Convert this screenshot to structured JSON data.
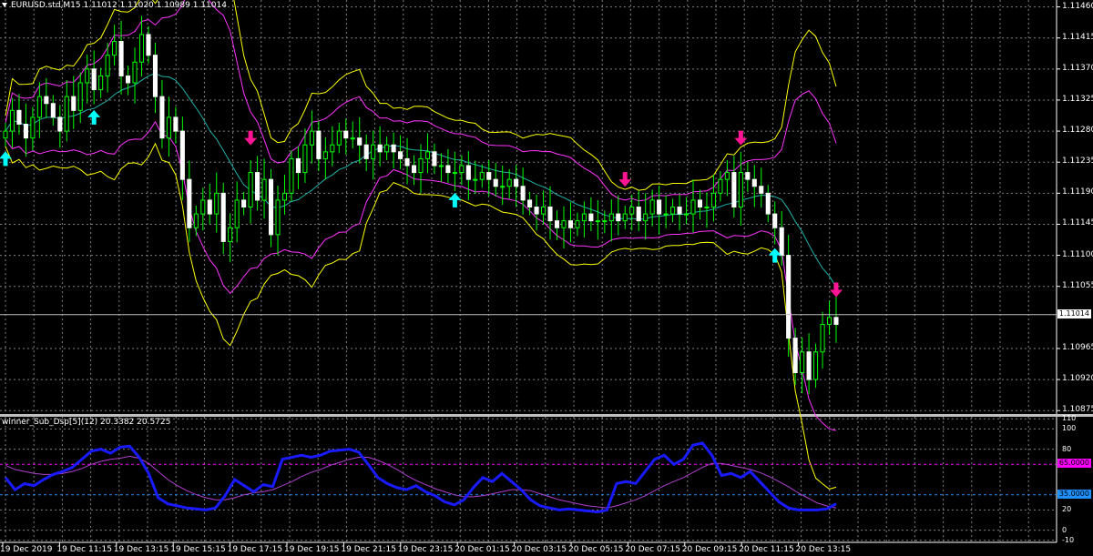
{
  "chart": {
    "symbol_title": "EURUSD.std,M15  1.11012 1.11020 1.10989 1.11014",
    "current_price": "1.11014",
    "price_ticks": [
      "1.11460",
      "1.11415",
      "1.11370",
      "1.11325",
      "1.11280",
      "1.11235",
      "1.11190",
      "1.11145",
      "1.11100",
      "1.11055",
      "1.10965",
      "1.10920",
      "1.10875"
    ]
  },
  "indicator": {
    "title": "winner_Sub_Dsp[5](12) 20.3382 20.5725",
    "level_high": "65.0000",
    "level_low": "35.0000",
    "ticks": [
      "110",
      "100",
      "80",
      "20",
      "0",
      "-10"
    ]
  },
  "time_axis": [
    "19 Dec 2019",
    "19 Dec 11:15",
    "19 Dec 13:15",
    "19 Dec 15:15",
    "19 Dec 17:15",
    "19 Dec 19:15",
    "19 Dec 21:15",
    "19 Dec 23:15",
    "20 Dec 01:15",
    "20 Dec 03:15",
    "20 Dec 05:15",
    "20 Dec 07:15",
    "20 Dec 09:15",
    "20 Dec 11:15",
    "20 Dec 13:15"
  ],
  "colors": {
    "background": "#000000",
    "grid": "#7f7f7f",
    "bull_candle": "#ffffff",
    "bear_candle": "#ffffff",
    "wick": "#00ff00",
    "band_outer": "#ffff00",
    "band_mid": "#ff33ff",
    "band_center": "#20b2aa",
    "arrow_up": "#00ffff",
    "arrow_down": "#ff1493",
    "osc_fast": "#1a1aff",
    "osc_slow": "#b040d0",
    "level_high": "#ff00ff",
    "level_low": "#1e90ff"
  },
  "chart_data": {
    "type": "candlestick",
    "closes": [
      1.1128,
      1.1131,
      1.1129,
      1.1127,
      1.113,
      1.1133,
      1.1132,
      1.113,
      1.1128,
      1.1133,
      1.1131,
      1.1135,
      1.1137,
      1.1134,
      1.1136,
      1.1139,
      1.1141,
      1.1136,
      1.1135,
      1.1138,
      1.1142,
      1.1139,
      1.1133,
      1.1127,
      1.113,
      1.1128,
      1.1121,
      1.1114,
      1.1116,
      1.1118,
      1.1116,
      1.1119,
      1.1112,
      1.1114,
      1.1118,
      1.1117,
      1.1122,
      1.1118,
      1.1121,
      1.1113,
      1.1118,
      1.1119,
      1.1124,
      1.1122,
      1.1126,
      1.1128,
      1.1124,
      1.1125,
      1.1126,
      1.1128,
      1.1127,
      1.1127,
      1.1126,
      1.1124,
      1.1126,
      1.1125,
      1.1126,
      1.1125,
      1.1124,
      1.1123,
      1.1122,
      1.1124,
      1.1125,
      1.1123,
      1.1123,
      1.1122,
      1.1122,
      1.1123,
      1.1121,
      1.1121,
      1.1122,
      1.1121,
      1.112,
      1.112,
      1.1121,
      1.112,
      1.1118,
      1.1117,
      1.1116,
      1.1117,
      1.1115,
      1.1114,
      1.1115,
      1.1114,
      1.1115,
      1.1116,
      1.1115,
      1.1115,
      1.1115,
      1.1116,
      1.1115,
      1.1116,
      1.1117,
      1.1115,
      1.1116,
      1.1118,
      1.1116,
      1.1116,
      1.1117,
      1.1116,
      1.1116,
      1.1118,
      1.1117,
      1.1117,
      1.1119,
      1.1121,
      1.1122,
      1.1117,
      1.1122,
      1.1121,
      1.112,
      1.1119,
      1.1116,
      1.1114,
      1.111,
      1.1098,
      1.1093,
      1.1096,
      1.1092,
      1.1096,
      1.11,
      1.1101,
      1.11
    ],
    "buy_arrows_at_bar": [
      0,
      13,
      66,
      113
    ],
    "sell_arrows_at_bar": [
      36,
      91,
      108,
      127
    ],
    "oscillator_fast": [
      52,
      40,
      46,
      44,
      50,
      55,
      58,
      62,
      70,
      78,
      80,
      76,
      82,
      83,
      72,
      56,
      32,
      26,
      24,
      22,
      21,
      20,
      22,
      34,
      50,
      44,
      38,
      45,
      43,
      70,
      72,
      74,
      72,
      74,
      78,
      79,
      80,
      77,
      65,
      52,
      46,
      42,
      40,
      44,
      38,
      34,
      28,
      25,
      30,
      42,
      52,
      48,
      56,
      48,
      40,
      30,
      24,
      22,
      20,
      21,
      20,
      19,
      18,
      20,
      46,
      48,
      46,
      58,
      70,
      74,
      65,
      70,
      84,
      86,
      74,
      54,
      56,
      52,
      58,
      48,
      38,
      28,
      22,
      20,
      20,
      20,
      21,
      26
    ],
    "oscillator_slow": [
      64,
      60,
      58,
      56,
      55,
      55,
      56,
      58,
      61,
      65,
      68,
      70,
      71,
      73,
      71,
      66,
      58,
      50,
      44,
      39,
      35,
      32,
      30,
      30,
      32,
      35,
      37,
      38,
      40,
      44,
      48,
      53,
      57,
      60,
      64,
      67,
      70,
      72,
      72,
      69,
      65,
      60,
      54,
      49,
      45,
      41,
      38,
      35,
      33,
      33,
      34,
      36,
      38,
      40,
      40,
      39,
      36,
      33,
      30,
      28,
      26,
      24,
      23,
      22,
      24,
      27,
      30,
      34,
      39,
      44,
      48,
      52,
      57,
      62,
      66,
      66,
      64,
      62,
      60,
      57,
      53,
      48,
      43,
      37,
      32,
      27,
      24,
      22
    ],
    "levels": [
      65,
      35
    ]
  }
}
